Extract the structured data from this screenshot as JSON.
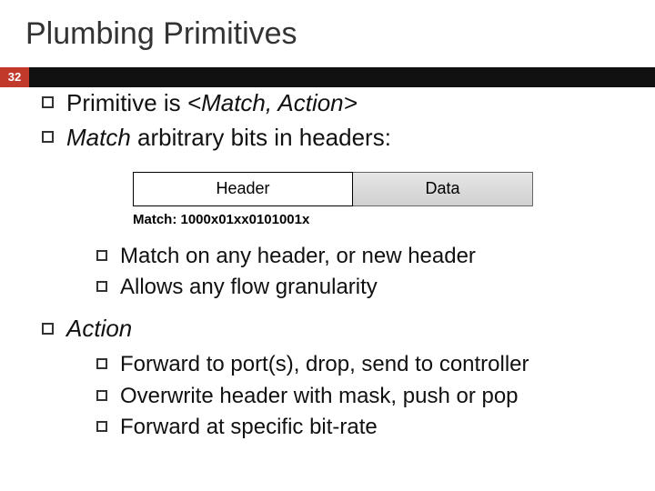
{
  "slide": {
    "title": "Plumbing Primitives",
    "page_number": "32",
    "bullets": [
      {
        "prefix": "Primitive is ",
        "match_action": "<Match, Action>"
      },
      {
        "match_word": "Match",
        "rest": " arbitrary bits in headers:"
      }
    ],
    "packet": {
      "header_label": "Header",
      "data_label": "Data"
    },
    "match_example": "Match: 1000x01xx0101001x",
    "match_sub": [
      "Match on any header, or new header",
      "Allows any flow granularity"
    ],
    "action_label": "Action",
    "action_sub": [
      "Forward to port(s), drop, send to controller",
      "Overwrite header with mask, push or pop",
      "Forward at specific bit-rate"
    ]
  }
}
